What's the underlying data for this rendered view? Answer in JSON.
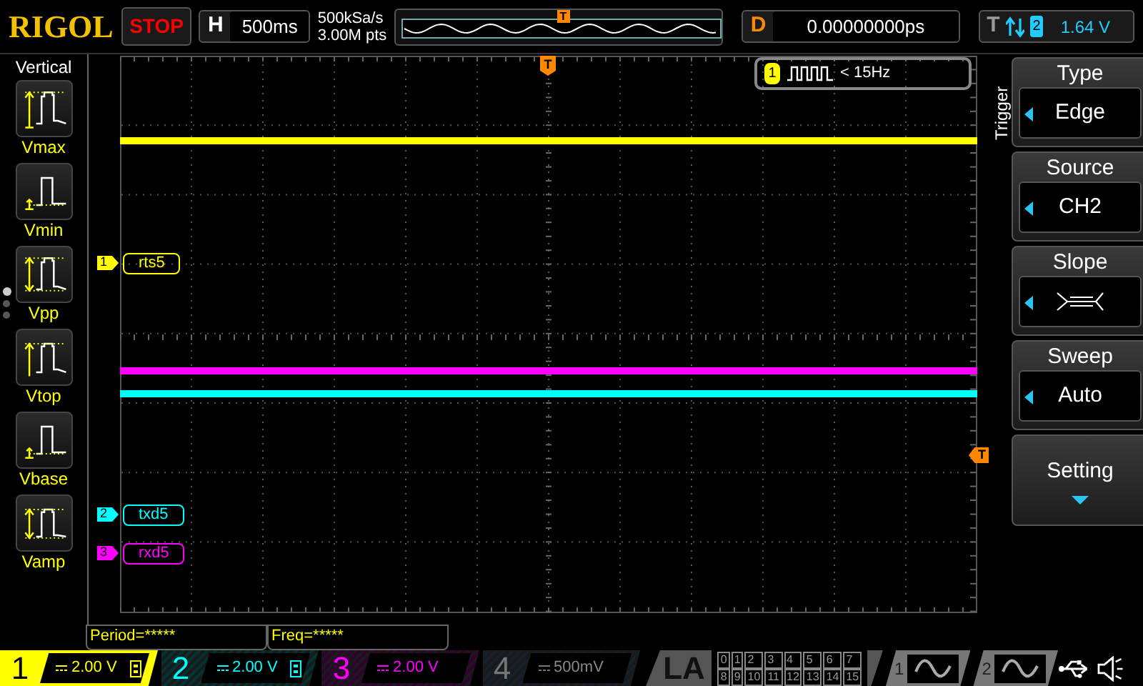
{
  "brand": "RIGOL",
  "run_state": "STOP",
  "timebase": {
    "label": "H",
    "value": "500ms"
  },
  "sample_rate": "500kSa/s",
  "memory_depth": "3.00M pts",
  "delay": {
    "label": "D",
    "value": "0.00000000ps"
  },
  "trigger_status": {
    "label": "T",
    "source": "2",
    "level": "1.64 V"
  },
  "left_menu": {
    "title": "Vertical",
    "items": [
      {
        "label": "Vmax",
        "kind": "max"
      },
      {
        "label": "Vmin",
        "kind": "min"
      },
      {
        "label": "Vpp",
        "kind": "pp"
      },
      {
        "label": "Vtop",
        "kind": "top"
      },
      {
        "label": "Vbase",
        "kind": "base"
      },
      {
        "label": "Vamp",
        "kind": "amp"
      }
    ],
    "page_dots": [
      {
        "selected": true
      },
      {
        "selected": false
      },
      {
        "selected": false
      }
    ]
  },
  "overview_trigger_marker": "T",
  "trigger_position_marker": "T",
  "trigger_level_marker": "T",
  "trigger_info": {
    "source": "1",
    "text": "< 15Hz"
  },
  "channel_labels": [
    {
      "number": "1",
      "name": "rts5",
      "color": "#ffff00"
    },
    {
      "number": "2",
      "name": "txd5",
      "color": "#00ffff"
    },
    {
      "number": "3",
      "name": "rxd5",
      "color": "#ff00ff"
    }
  ],
  "trigger_menu": {
    "title": "Trigger",
    "items": [
      {
        "label": "Type",
        "kind": "value",
        "value": "Edge"
      },
      {
        "label": "Source",
        "kind": "value",
        "value": "CH2"
      },
      {
        "label": "Slope",
        "kind": "slope"
      },
      {
        "label": "Sweep",
        "kind": "value",
        "value": "Auto"
      },
      {
        "label": "Setting",
        "kind": "submenu"
      }
    ]
  },
  "measurements": [
    "Period=*****",
    "Freq=*****"
  ],
  "channels": [
    {
      "number": "1",
      "scale": "2.00 V",
      "color": "#ffff00",
      "on": true,
      "selected": true,
      "bandwidth_limit": true
    },
    {
      "number": "2",
      "scale": "2.00 V",
      "color": "#00ffff",
      "on": true,
      "selected": false,
      "bandwidth_limit": true
    },
    {
      "number": "3",
      "scale": "2.00 V",
      "color": "#ff00ff",
      "on": true,
      "selected": false,
      "bandwidth_limit": false
    },
    {
      "number": "4",
      "scale": "500mV",
      "color": "#777777",
      "on": false,
      "selected": false,
      "bandwidth_limit": false
    }
  ],
  "la": {
    "label": "LA",
    "bits": [
      "0",
      "1",
      "2",
      "3",
      "4",
      "5",
      "6",
      "7",
      "8",
      "9",
      "10",
      "11",
      "12",
      "13",
      "14",
      "15"
    ]
  },
  "generators": [
    {
      "number": "1"
    },
    {
      "number": "2"
    }
  ]
}
